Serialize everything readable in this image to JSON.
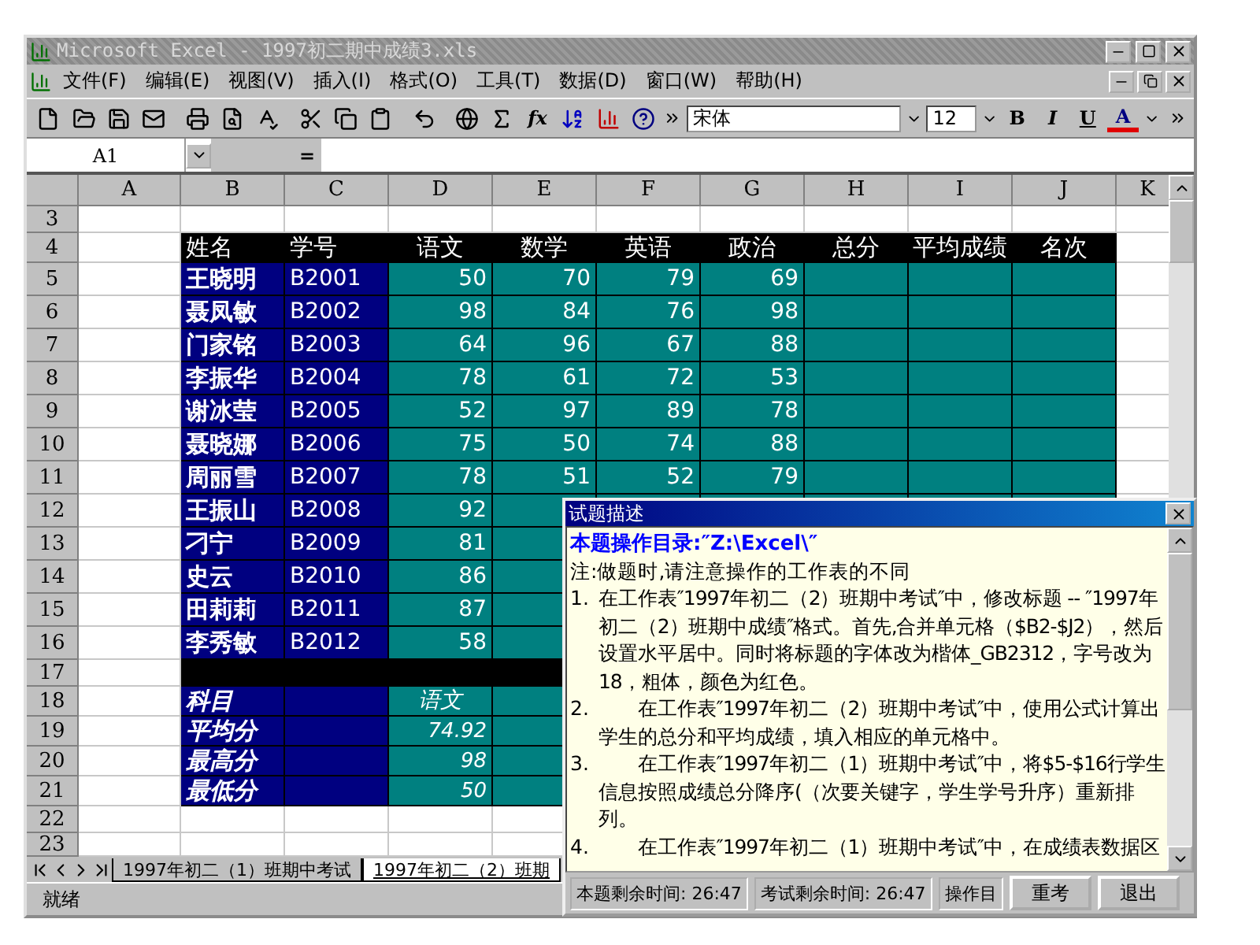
{
  "window": {
    "title": "Microsoft Excel - 1997初二期中成绩3.xls"
  },
  "menu": [
    "文件(F)",
    "编辑(E)",
    "视图(V)",
    "插入(I)",
    "格式(O)",
    "工具(T)",
    "数据(D)",
    "窗口(W)",
    "帮助(H)"
  ],
  "toolbar": {
    "function_label": "fx",
    "font": "宋体",
    "size": "12",
    "bold": "B",
    "italic": "I",
    "underline": "U",
    "font_color": "A"
  },
  "formula_bar": {
    "name_box": "A1",
    "equals": "="
  },
  "columns": [
    "A",
    "B",
    "C",
    "D",
    "E",
    "F",
    "G",
    "H",
    "I",
    "J",
    "K"
  ],
  "rows": [
    {
      "number": "3",
      "kind": "empty"
    },
    {
      "number": "4",
      "kind": "header",
      "cells": [
        "姓名",
        "学号",
        "语文",
        "数学",
        "英语",
        "政治",
        "总分",
        "平均成绩",
        "名次"
      ]
    },
    {
      "number": "5",
      "kind": "student",
      "cells": [
        "王晓明",
        "B2001",
        "50",
        "70",
        "79",
        "69",
        null,
        null,
        null
      ]
    },
    {
      "number": "6",
      "kind": "student",
      "cells": [
        "聂凤敏",
        "B2002",
        "98",
        "84",
        "76",
        "98",
        null,
        null,
        null
      ]
    },
    {
      "number": "7",
      "kind": "student",
      "cells": [
        "门家铭",
        "B2003",
        "64",
        "96",
        "67",
        "88",
        null,
        null,
        null
      ]
    },
    {
      "number": "8",
      "kind": "student",
      "cells": [
        "李振华",
        "B2004",
        "78",
        "61",
        "72",
        "53",
        null,
        null,
        null
      ]
    },
    {
      "number": "9",
      "kind": "student",
      "cells": [
        "谢冰莹",
        "B2005",
        "52",
        "97",
        "89",
        "78",
        null,
        null,
        null
      ]
    },
    {
      "number": "10",
      "kind": "student",
      "cells": [
        "聂晓娜",
        "B2006",
        "75",
        "50",
        "74",
        "88",
        null,
        null,
        null
      ]
    },
    {
      "number": "11",
      "kind": "student",
      "cells": [
        "周丽雪",
        "B2007",
        "78",
        "51",
        "52",
        "79",
        null,
        null,
        null
      ]
    },
    {
      "number": "12",
      "kind": "student",
      "cells": [
        "王振山",
        "B2008",
        "92",
        null,
        null,
        null,
        null,
        null,
        null
      ]
    },
    {
      "number": "13",
      "kind": "student",
      "cells": [
        "刁宁",
        "B2009",
        "81",
        null,
        null,
        null,
        null,
        null,
        null
      ]
    },
    {
      "number": "14",
      "kind": "student",
      "cells": [
        "史云",
        "B2010",
        "86",
        null,
        null,
        null,
        null,
        null,
        null
      ]
    },
    {
      "number": "15",
      "kind": "student",
      "cells": [
        "田莉莉",
        "B2011",
        "87",
        null,
        null,
        null,
        null,
        null,
        null
      ]
    },
    {
      "number": "16",
      "kind": "student",
      "cells": [
        "李秀敏",
        "B2012",
        "58",
        null,
        null,
        null,
        null,
        null,
        null
      ]
    },
    {
      "number": "17",
      "kind": "band"
    },
    {
      "number": "18",
      "kind": "summary-head",
      "cells": [
        "科目",
        null,
        "语文",
        null,
        null,
        null,
        null,
        null,
        null
      ]
    },
    {
      "number": "19",
      "kind": "summary",
      "cells": [
        "平均分",
        null,
        "74.92",
        null,
        null,
        null,
        null,
        null,
        null
      ]
    },
    {
      "number": "20",
      "kind": "summary",
      "cells": [
        "最高分",
        null,
        "98",
        null,
        null,
        null,
        null,
        null,
        null
      ]
    },
    {
      "number": "21",
      "kind": "summary",
      "cells": [
        "最低分",
        null,
        "50",
        null,
        null,
        null,
        null,
        null,
        null
      ]
    },
    {
      "number": "22",
      "kind": "empty"
    },
    {
      "number": "23",
      "kind": "empty"
    }
  ],
  "sheet_tabs": [
    {
      "label": "1997年初二（1）班期中考试",
      "selected": false
    },
    {
      "label": "1997年初二（2）班期",
      "selected": true
    }
  ],
  "status_bar": "就绪",
  "dialog": {
    "title": "试题描述",
    "directory": "本题操作目录:″Z:\\Excel\\″",
    "note": "注:做题时,请注意操作的工作表的不同",
    "items": [
      {
        "number": "1.",
        "text": "在工作表″1997年初二（2）班期中考试″中，修改标题 -- ″1997年初二（2）班期中成绩″格式。首先,合并单元格（$B2-$J2），然后设置水平居中。同时将标题的字体改为楷体_GB2312，字号改为18，粗体，颜色为红色。"
      },
      {
        "number": "2.",
        "text": "　　在工作表″1997年初二（2）班期中考试″中，使用公式计算出学生的总分和平均成绩，填入相应的单元格中。"
      },
      {
        "number": "3.",
        "text": "　　在工作表″1997年初二（1）班期中考试″中，将$5-$16行学生信息按照成绩总分降序(（次要关键字，学生学号升序）重新排列。"
      },
      {
        "number": "4.",
        "text": "　　在工作表″1997年初二（1）班期中考试″中，在成绩表数据区"
      }
    ],
    "timers": [
      "本题剩余时间: 26:47",
      "考试剩余时间: 26:47",
      "操作目"
    ],
    "buttons": [
      "重考",
      "退出"
    ]
  }
}
